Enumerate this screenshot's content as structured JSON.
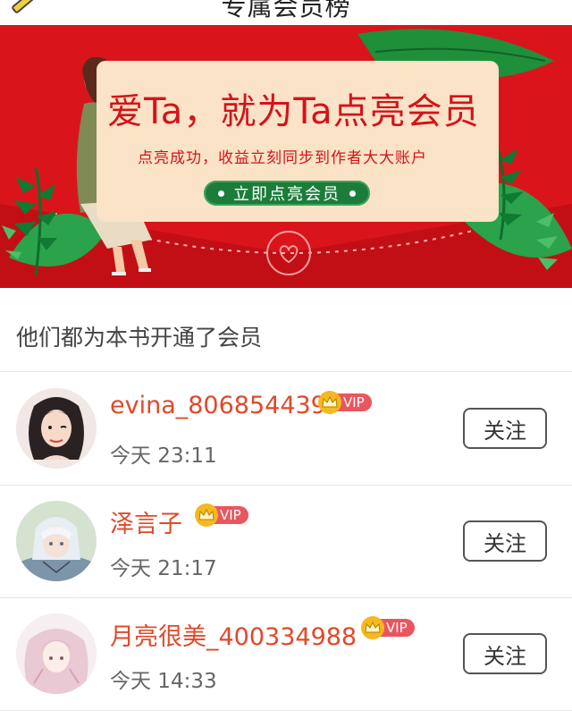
{
  "header": {
    "title": "专属会员榜"
  },
  "banner": {
    "headline": "爱Ta，就为Ta点亮会员",
    "subline": "点亮成功，收益立刻同步到作者大大账户",
    "cta_label": "立即点亮会员"
  },
  "section": {
    "title": "他们都为本书开通了会员"
  },
  "members": [
    {
      "name": "evina_806854439",
      "vip": "VIP",
      "time": "今天 23:11",
      "follow_label": "关注"
    },
    {
      "name": "泽言子",
      "vip": "VIP",
      "time": "今天 21:17",
      "follow_label": "关注"
    },
    {
      "name": "月亮很美_400334988",
      "vip": "VIP",
      "time": "今天 14:33",
      "follow_label": "关注"
    }
  ],
  "icons": [
    "edit-pencil-icon",
    "crown-icon",
    "heart-seal-icon"
  ],
  "colors": {
    "banner_red": "#d9151b",
    "card_cream": "#fbe3c7",
    "name_orange": "#e0492a",
    "vip_red": "#e9565f",
    "cta_green": "#1c7d3a"
  }
}
